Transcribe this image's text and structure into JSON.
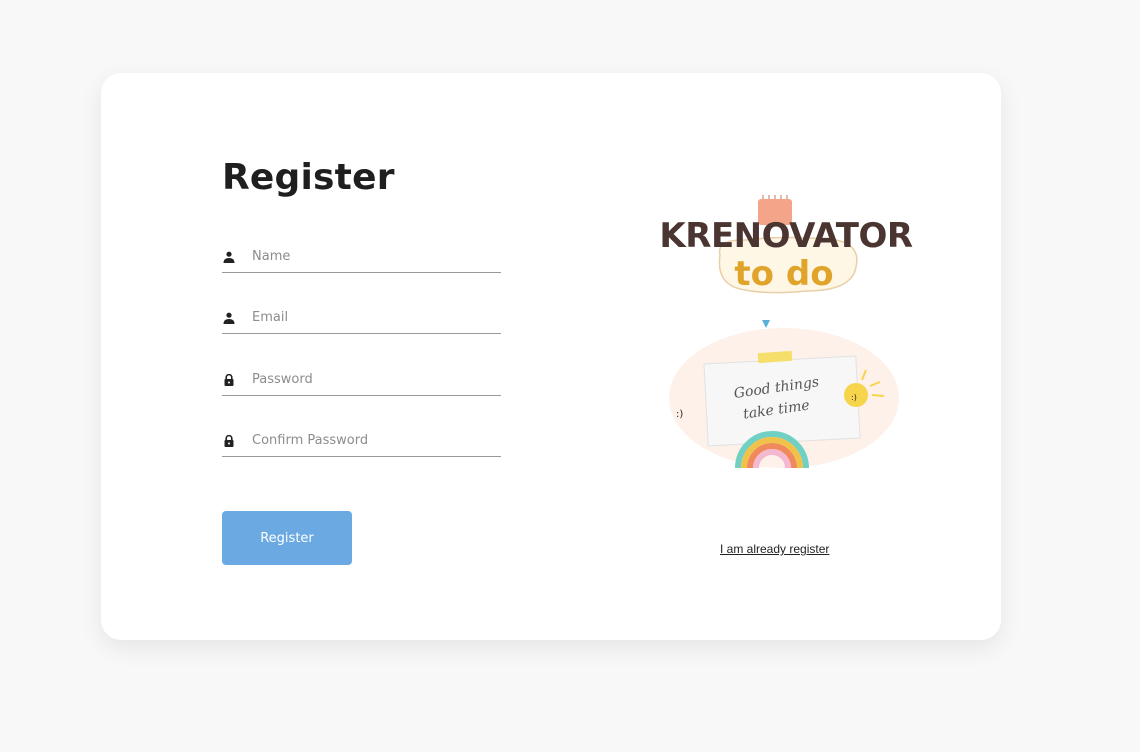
{
  "form": {
    "title": "Register",
    "fields": [
      {
        "placeholder": "Name",
        "icon": "person-icon"
      },
      {
        "placeholder": "Email",
        "icon": "person-icon"
      },
      {
        "placeholder": "Password",
        "icon": "lock-icon"
      },
      {
        "placeholder": "Confirm Password",
        "icon": "lock-icon"
      }
    ],
    "submit_label": "Register"
  },
  "branding": {
    "logo_top": "KRENOVATOR",
    "logo_bottom": "to do",
    "note_line1": "Good things",
    "note_line2": "take time"
  },
  "login_link": "I am already register",
  "colors": {
    "button": "#6aa9e2",
    "logo_dark": "#4a3530",
    "logo_accent": "#e0a42a"
  }
}
